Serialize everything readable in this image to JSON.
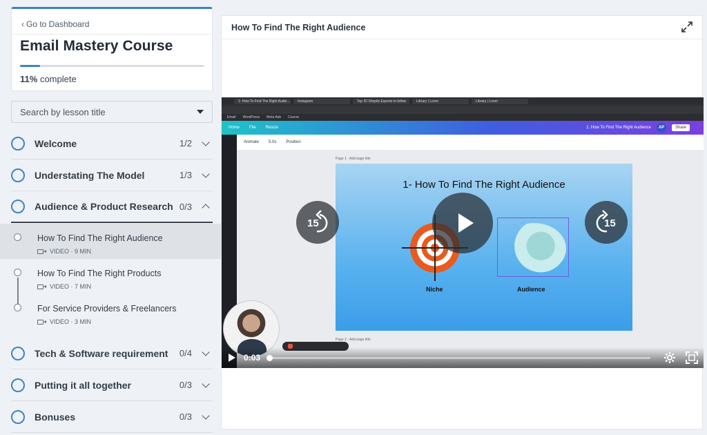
{
  "sidebar": {
    "back_label": "Go to Dashboard",
    "course_title": "Email Mastery Course",
    "progress_percent": 11,
    "progress_value": "11%",
    "progress_suffix": "complete",
    "search_placeholder": "Search by lesson title",
    "sections": [
      {
        "title": "Welcome",
        "count": "1/2",
        "open": false
      },
      {
        "title": "Understating The Model",
        "count": "1/3",
        "open": false
      },
      {
        "title": "Audience & Product Research",
        "count": "0/3",
        "open": true
      },
      {
        "title": "Tech & Software requirement",
        "count": "0/4",
        "open": false
      },
      {
        "title": "Putting it all together",
        "count": "0/3",
        "open": false
      },
      {
        "title": "Bonuses",
        "count": "0/3",
        "open": false
      }
    ],
    "lessons": [
      {
        "title": "How To Find The Right Audience",
        "meta": "VIDEO · 9 MIN",
        "active": true
      },
      {
        "title": "How To Find The Right Products",
        "meta": "VIDEO · 7 MIN",
        "active": false
      },
      {
        "title": "For Service Providers & Freelancers",
        "meta": "VIDEO · 3 MIN",
        "active": false
      }
    ]
  },
  "main": {
    "lesson_title": "How To Find The Right Audience"
  },
  "video": {
    "current_time": "0:03",
    "progress_fraction": 0.006,
    "skip_back": "15",
    "skip_forward": "15",
    "browser_tabs": [
      "1- How To Find The Right Audie...",
      "Instagram",
      "Top 20 Shopify Experts to follow",
      "Library | Loom",
      "Library | Loom"
    ],
    "bookmarks": [
      "Email",
      "WordPress",
      "Meta Ads",
      "Course"
    ],
    "canva_menu": [
      "Home",
      "File",
      "Resize"
    ],
    "canva_doc_title": "1. How To Find The Right Audience",
    "canva_avatar": "AP",
    "canva_share": "Share",
    "canva_tools": [
      "Animate",
      "5.0s",
      "Position"
    ],
    "page1_label": "Page 1 - Add page title",
    "page2_label": "Page 2 - Add page title",
    "slide_title": "1- How To Find The Right Audience",
    "slide_label_left": "Niche",
    "slide_label_right": "Audience"
  },
  "colors": {
    "accent": "#3c84c7"
  }
}
